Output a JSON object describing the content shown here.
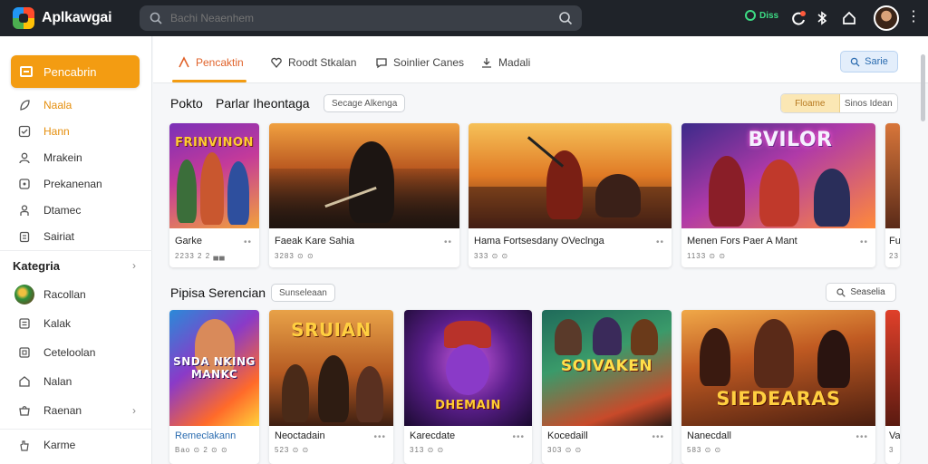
{
  "app": {
    "name": "Aplkawgai"
  },
  "search": {
    "placeholder": "Bachi Neaenhem"
  },
  "header": {
    "status_label": "Diss"
  },
  "sidebar": {
    "active": "Pencabrin",
    "items": [
      "Naala",
      "Hann",
      "Mrakein",
      "Prekanenan",
      "Dtamec",
      "Sairiat"
    ],
    "category_heading": "Kategria",
    "category_items": [
      "Racollan",
      "Kalak",
      "Ceteloolan",
      "Nalan",
      "Raenan",
      "Karme"
    ]
  },
  "tabs": {
    "items": [
      "Pencaktin",
      "Roodt Stkalan",
      "Soinlier Canes",
      "Madali"
    ],
    "action_button": "Sarie"
  },
  "section1": {
    "title_left": "Pokto",
    "title": "Parlar Iheontaga",
    "chip": "Secage Alkenga",
    "toggle": [
      "Floame",
      "Sinos Idean"
    ],
    "cards": [
      {
        "art_text": "FRINVINON",
        "title": "Garke",
        "meta": "2233 2 2 ▄▄"
      },
      {
        "art_text": "",
        "title": "Faeak Kare Sahia",
        "meta": "3283 ⊙ ⊙"
      },
      {
        "art_text": "",
        "title": "Hama Fortsesdany OVeclnga",
        "meta": "333 ⊙ ⊙"
      },
      {
        "art_text": "BVILOR",
        "title": "Menen Fors Paer A Mant",
        "meta": "1133 ⊙ ⊙"
      },
      {
        "art_text": "",
        "title": "Fu",
        "meta": "23"
      }
    ]
  },
  "section2": {
    "title": "Pipisa Serencian",
    "chip": "Sunseleaan",
    "search_button": "Seaselia",
    "cards": [
      {
        "art_text": "SNDA NKING MANKC",
        "title": "Remeclakann",
        "meta": "Bao ⊙ 2 ⊙ ⊙"
      },
      {
        "art_text": "SRUIAN",
        "title": "Neoctadain",
        "meta": "523 ⊙ ⊙"
      },
      {
        "art_text": "DHEMAIN",
        "title": "Karecdate",
        "meta": "313 ⊙ ⊙"
      },
      {
        "art_text": "SOIVAKEN",
        "title": "Kocedaill",
        "meta": "303 ⊙ ⊙"
      },
      {
        "art_text": "SIEDEARAS",
        "title": "Nanecdall",
        "meta": "583 ⊙ ⊙"
      },
      {
        "art_text": "",
        "title": "Va",
        "meta": "3"
      }
    ]
  },
  "colors": {
    "accent": "#f39c12",
    "topbar": "#1f2329",
    "tab_active": "#e0622a",
    "status": "#3ddc84"
  },
  "icons": [
    "logo-icon",
    "search-icon",
    "status-icon",
    "refresh-icon",
    "bluetooth-icon",
    "home-icon",
    "more-icon"
  ]
}
